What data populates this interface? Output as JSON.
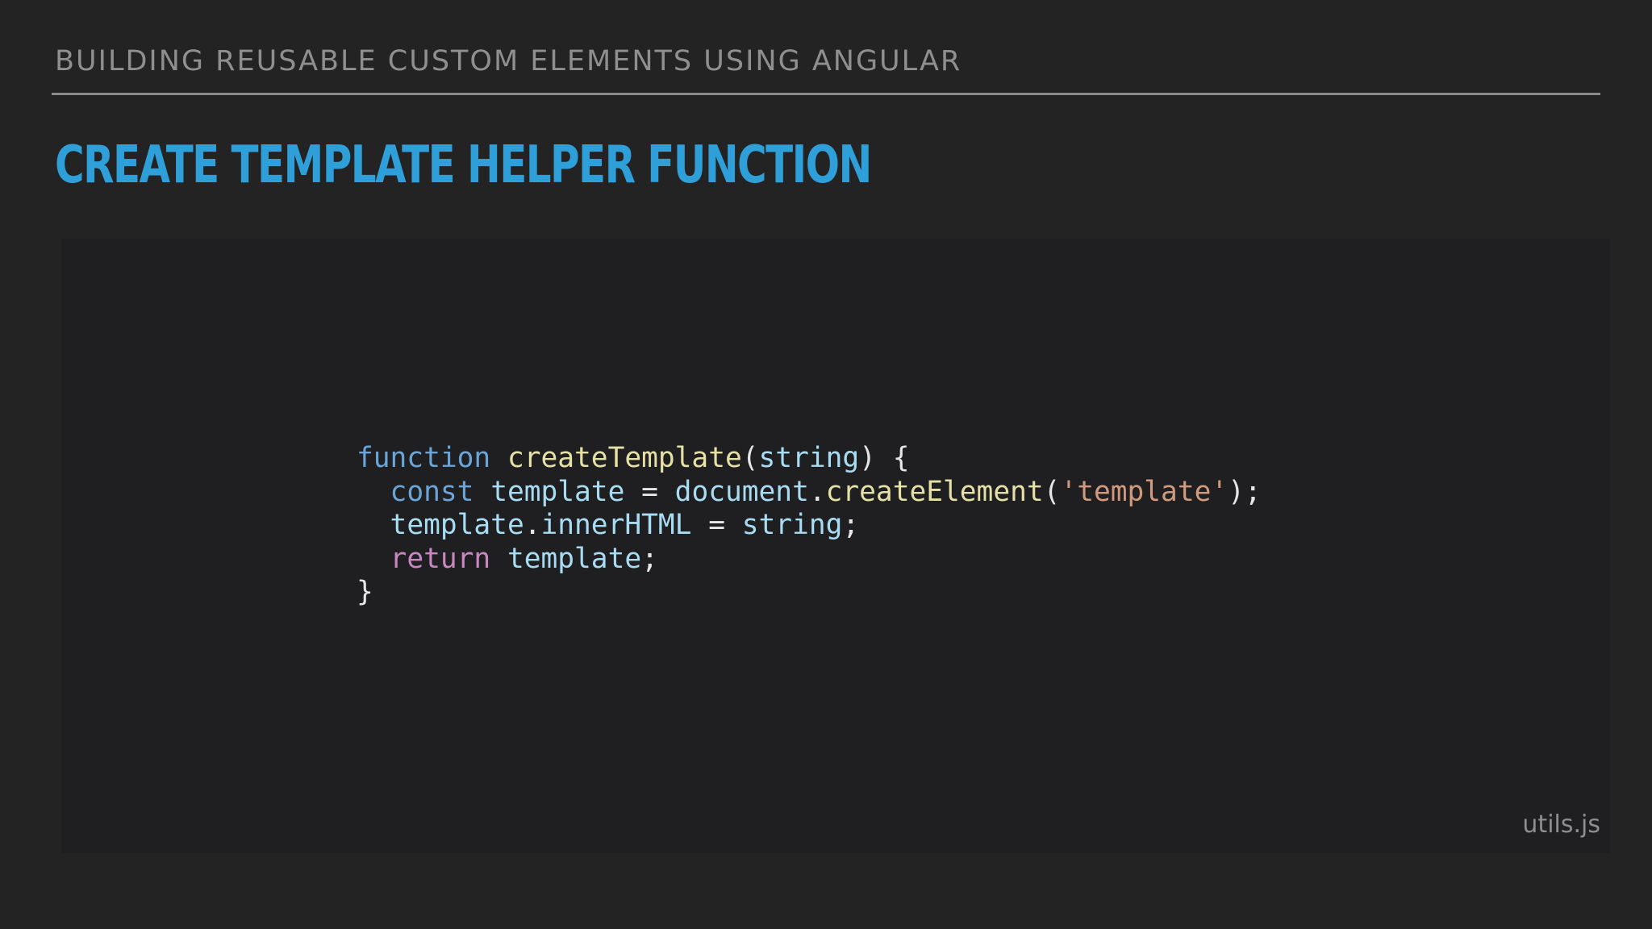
{
  "header": {
    "title": "BUILDING REUSABLE CUSTOM ELEMENTS USING ANGULAR"
  },
  "slide": {
    "title": "CREATE TEMPLATE HELPER FUNCTION"
  },
  "code": {
    "filename": "utils.js",
    "line1": {
      "kw_function": "function",
      "fn_name": "createTemplate",
      "open_paren": "(",
      "param": "string",
      "close_brace": ") {"
    },
    "line2": {
      "indent": "  ",
      "kw_const": "const",
      "var_template": "template",
      "eq": " = ",
      "obj_document": "document",
      "dot": ".",
      "method": "createElement",
      "open_paren": "(",
      "str": "'template'",
      "close": ");"
    },
    "line3": {
      "indent": "  ",
      "obj_template": "template",
      "dot": ".",
      "prop_innerHTML": "innerHTML",
      "eq": " = ",
      "val_string": "string",
      "semi": ";"
    },
    "line4": {
      "indent": "  ",
      "kw_return": "return",
      "val_template": "template",
      "semi": ";"
    },
    "line5": {
      "close": "}"
    }
  },
  "colors": {
    "background": "#232323",
    "panel": "#1f1f21",
    "title_accent": "#2e9fd8",
    "header_text": "#8f8f8f"
  }
}
